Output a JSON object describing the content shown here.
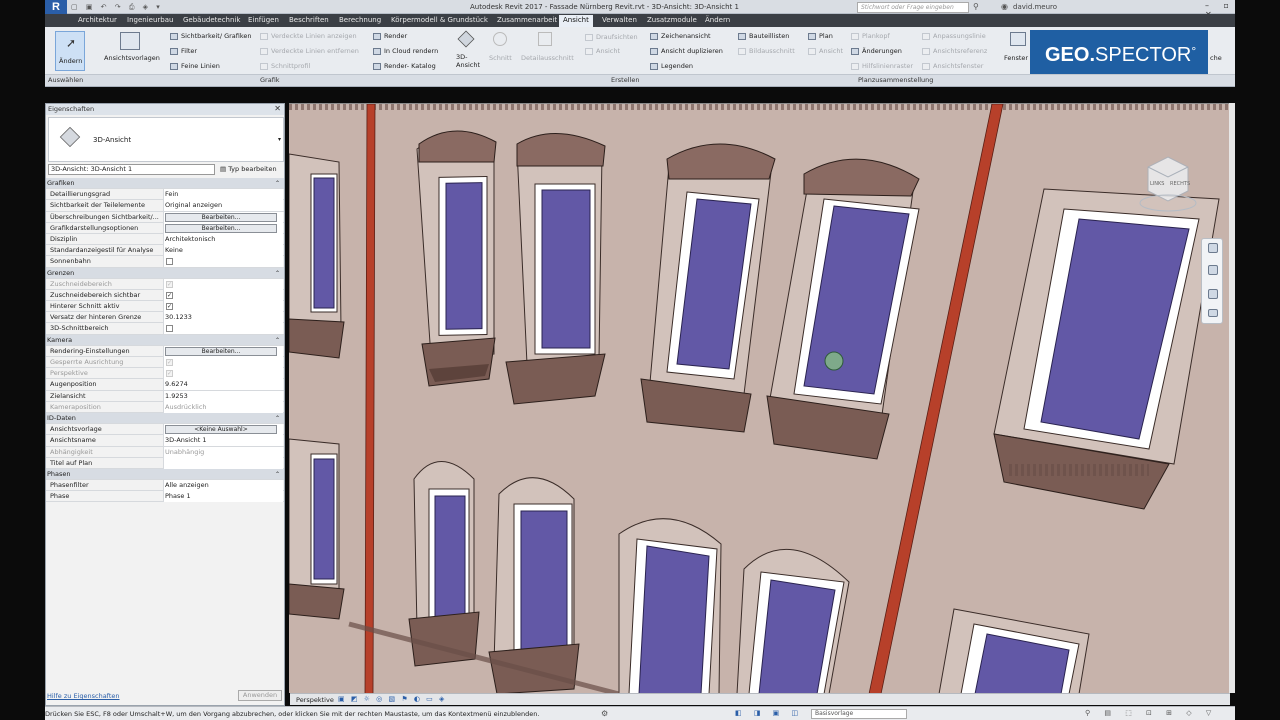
{
  "titlebar": {
    "logo": "R",
    "title": "Autodesk Revit 2017  -   Fassade Nürnberg Revit.rvt - 3D-Ansicht: 3D-Ansicht 1",
    "search_placeholder": "Stichwort oder Frage eingeben",
    "user": "david.meuro"
  },
  "tabs": [
    "Architektur",
    "Ingenieurbau",
    "Gebäudetechnik",
    "Einfügen",
    "Beschriften",
    "Berechnung",
    "Körpermodell & Grundstück",
    "Zusammenarbeit",
    "Ansicht",
    "Verwalten",
    "Zusatzmodule",
    "Ändern"
  ],
  "active_tab": "Ansicht",
  "ribbon": {
    "modify": "Ändern",
    "view_templates": "Ansichtsvorlagen",
    "visibility": "Sichtbarkeit/ Grafiken",
    "filter": "Filter",
    "thin_lines": "Feine Linien",
    "show_hidden": "Verdeckte Linien anzeigen",
    "remove_hidden": "Verdeckte Linien entfernen",
    "section_profile": "Schnittprofil",
    "render": "Render",
    "cloud_render": "In Cloud  rendern",
    "render_gallery": "Render- Katalog",
    "view_3d": "3D-\nAnsicht",
    "section": "Schnitt",
    "callout": "Detailausschnitt",
    "plan_views": "Draufsichten",
    "elevation": "Ansicht",
    "drafting_view": "Zeichenansicht",
    "duplicate_view": "Ansicht duplizieren",
    "legends": "Legenden",
    "schedules": "Bauteillisten",
    "scope_box": "Bildausschnitt",
    "sheet": "Plan",
    "view": "Ansicht",
    "title_block": "Plankopf",
    "revisions": "Änderungen",
    "guide_grid": "Hilfslinienraster",
    "matchline": "Anpassungslinie",
    "view_reference": "Ansichtsreferenz",
    "viewports": "Ansichtsfenster",
    "switch_windows": "Fenster wechsel",
    "close": "che"
  },
  "panels": {
    "select": "Auswählen",
    "graphics": "Grafik",
    "create": "Erstellen",
    "sheet_composition": "Planzusammenstellung"
  },
  "geo": {
    "brand": "GEO.",
    "brand2": "SPECTOR",
    "mark": "°"
  },
  "properties": {
    "header": "Eigenschaften",
    "type_name": "3D-Ansicht",
    "instance": "3D-Ansicht: 3D-Ansicht 1",
    "edit_type": "Typ bearbeiten",
    "help": "Hilfe zu Eigenschaften",
    "apply": "Anwenden",
    "rows": [
      {
        "cat": "Grafiken"
      },
      {
        "k": "Detaillierungsgrad",
        "v": "Fein"
      },
      {
        "k": "Sichtbarkeit der Teilelemente",
        "v": "Original anzeigen"
      },
      {
        "k": "Überschreibungen Sichtbarkeit/...",
        "btn": "Bearbeiten..."
      },
      {
        "k": "Grafikdarstellungsoptionen",
        "btn": "Bearbeiten..."
      },
      {
        "k": "Disziplin",
        "v": "Architektonisch"
      },
      {
        "k": "Standardanzeigestil für Analyse",
        "v": "Keine"
      },
      {
        "k": "Sonnenbahn",
        "chk": "off"
      },
      {
        "cat": "Grenzen"
      },
      {
        "k": "Zuschneidebereich",
        "chk": "dis",
        "kdis": true
      },
      {
        "k": "Zuschneidebereich sichtbar",
        "chk": "on"
      },
      {
        "k": "Hinterer Schnitt aktiv",
        "chk": "on"
      },
      {
        "k": "Versatz der hinteren Grenze",
        "v": "30.1233"
      },
      {
        "k": "3D-Schnittbereich",
        "chk": "off"
      },
      {
        "cat": "Kamera"
      },
      {
        "k": "Rendering-Einstellungen",
        "btn": "Bearbeiten..."
      },
      {
        "k": "Gesperrte Ausrichtung",
        "chk": "dis",
        "kdis": true
      },
      {
        "k": "Perspektive",
        "chk": "dis",
        "kdis": true
      },
      {
        "k": "Augenposition",
        "v": "9.6274"
      },
      {
        "k": "Zielansicht",
        "v": "1.9253"
      },
      {
        "k": "Kameraposition",
        "v": "Ausdrücklich",
        "kdis": true,
        "vdis": true
      },
      {
        "cat": "ID-Daten"
      },
      {
        "k": "Ansichtsvorlage",
        "btn": "<Keine Auswahl>"
      },
      {
        "k": "Ansichtsname",
        "v": "3D-Ansicht 1"
      },
      {
        "k": "Abhängigkeit",
        "v": "Unabhängig",
        "kdis": true,
        "vdis": true
      },
      {
        "k": "Titel auf Plan",
        "v": ""
      },
      {
        "cat": "Phasen"
      },
      {
        "k": "Phasenfilter",
        "v": "Alle anzeigen"
      },
      {
        "k": "Phase",
        "v": "Phase 1"
      }
    ]
  },
  "viewbar": {
    "mode": "Perspektive"
  },
  "status": {
    "text": "Drücken Sie ESC, F8 oder Umschalt+W, um den Vorgang abzubrechen, oder klicken Sie mit der rechten Maustaste, um das Kontextmenü einzublenden.",
    "basis": "Basisvorlage"
  },
  "viewcube": {
    "face1": "LINKS",
    "face2": "RECHTS"
  },
  "colors": {
    "wall": "#c7b3ab",
    "glass": "#6258a6",
    "sill": "#7a5c54",
    "pipe": "#b7402a"
  }
}
